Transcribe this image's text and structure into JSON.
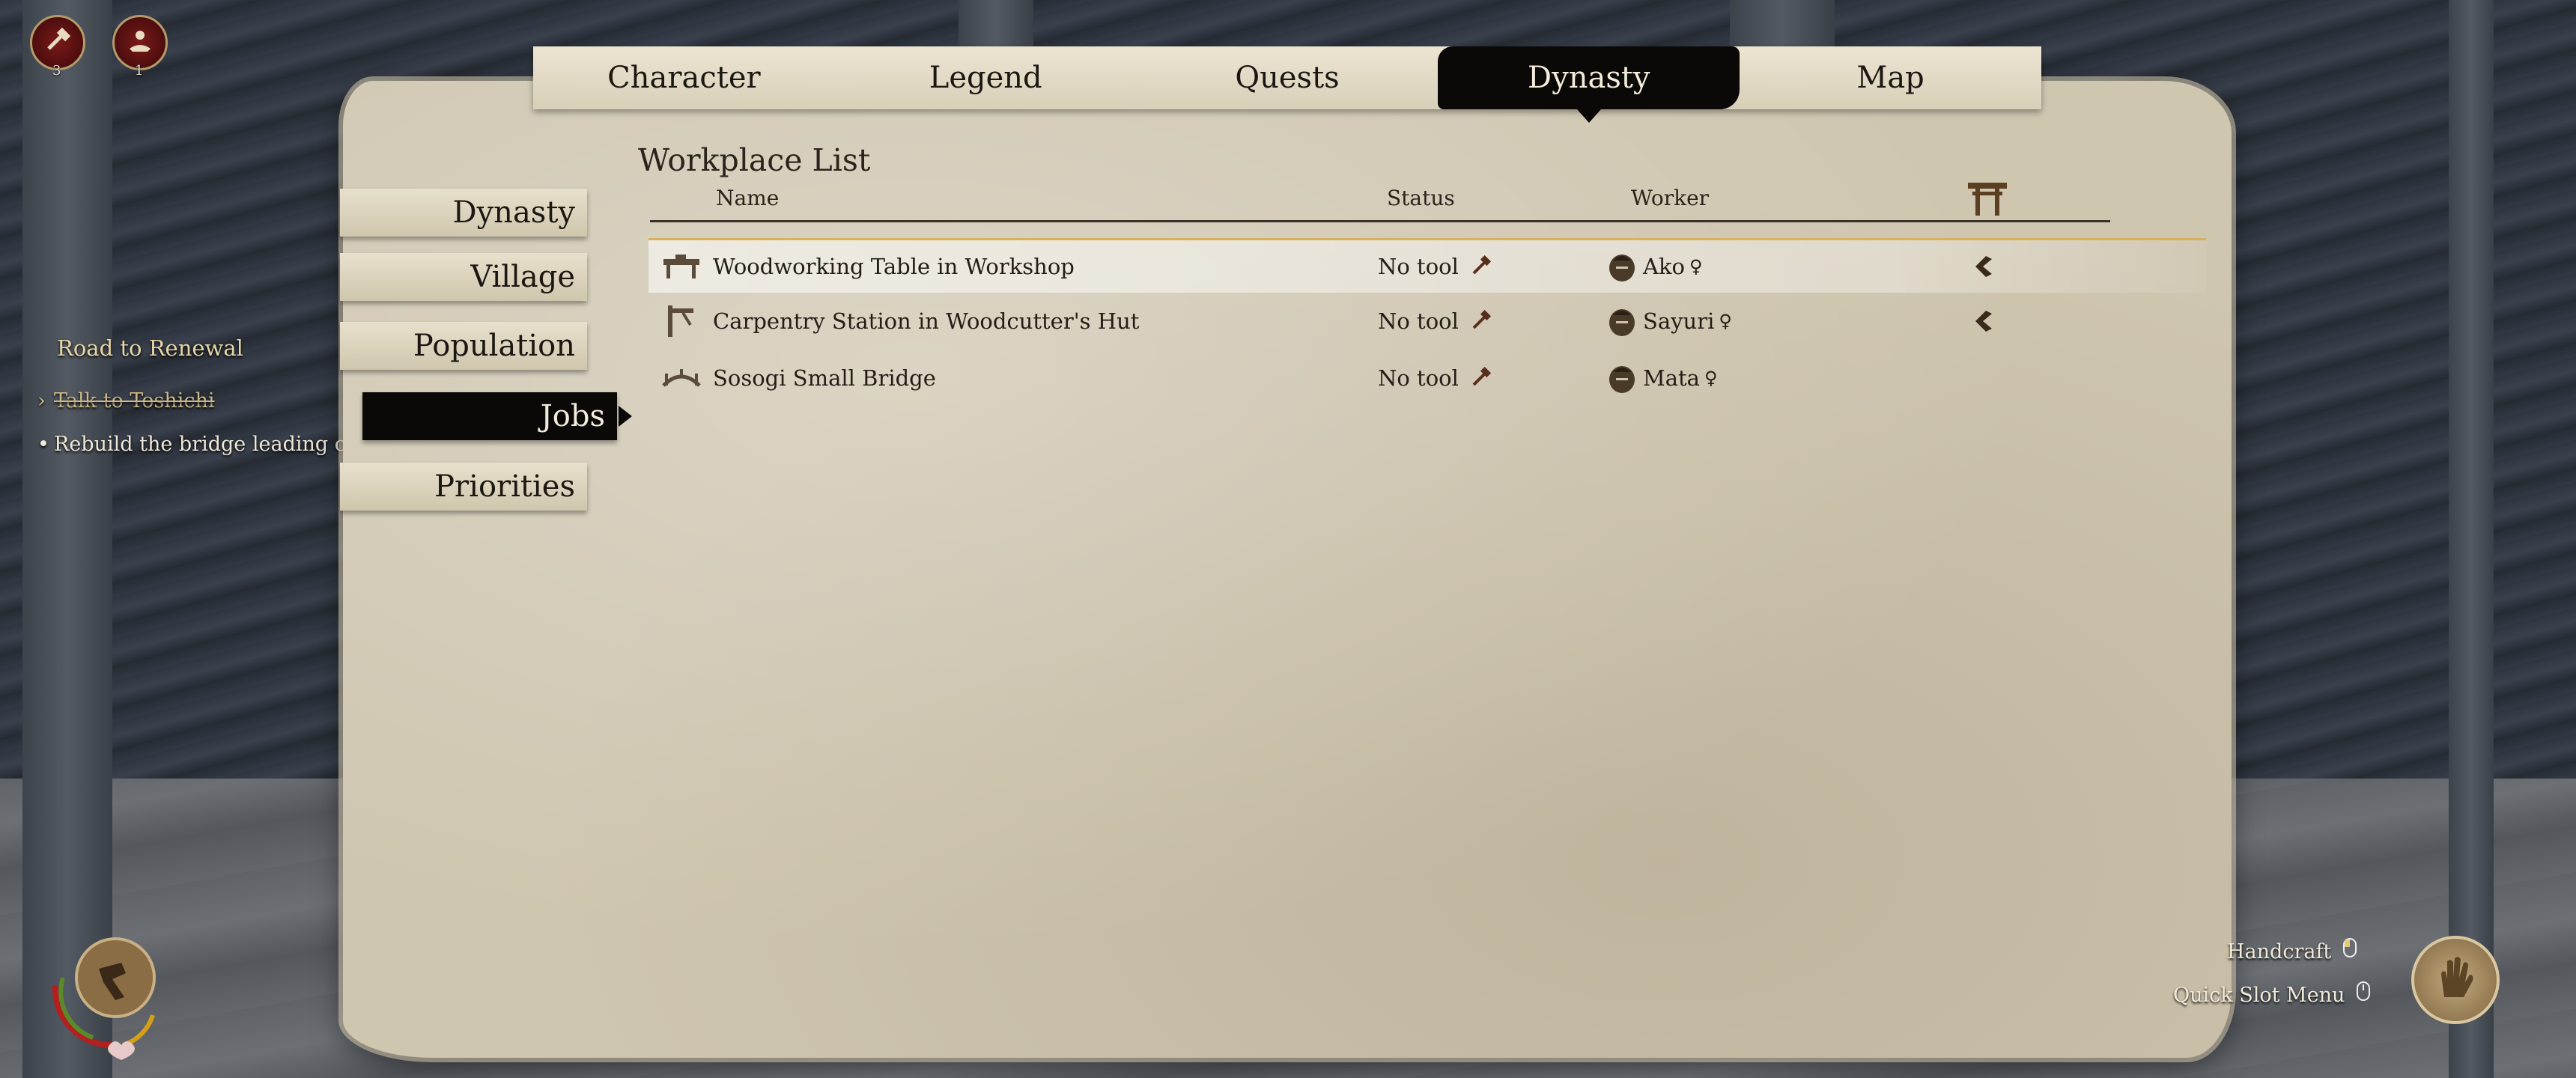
{
  "hud": {
    "badges": [
      {
        "icon": "hammer-icon",
        "count": "3"
      },
      {
        "icon": "villager-hand-icon",
        "count": "1"
      }
    ]
  },
  "tabs": [
    {
      "label": "Character",
      "active": false
    },
    {
      "label": "Legend",
      "active": false
    },
    {
      "label": "Quests",
      "active": false
    },
    {
      "label": "Dynasty",
      "active": true
    },
    {
      "label": "Map",
      "active": false
    }
  ],
  "side_menu": [
    {
      "label": "Dynasty",
      "active": false
    },
    {
      "label": "Village",
      "active": false
    },
    {
      "label": "Population",
      "active": false
    },
    {
      "label": "Jobs",
      "active": true
    },
    {
      "label": "Priorities",
      "active": false
    }
  ],
  "quest": {
    "title": "Road to Renewal",
    "steps": [
      {
        "label": "Talk to Toshichi",
        "done": true
      },
      {
        "label": "Rebuild the bridge leading out",
        "done": false
      }
    ]
  },
  "workplace": {
    "title": "Workplace List",
    "columns": {
      "name": "Name",
      "status": "Status",
      "worker": "Worker",
      "assign_icon": "shrine-gate-icon"
    },
    "rows": [
      {
        "icon": "workbench-icon",
        "name": "Woodworking Table in Workshop",
        "status": "No tool",
        "worker": "Ako",
        "gender": "♀",
        "has_action": true,
        "selected": true
      },
      {
        "icon": "carpentry-icon",
        "name": "Carpentry Station in Woodcutter's Hut",
        "status": "No tool",
        "worker": "Sayuri",
        "gender": "♀",
        "has_action": true,
        "selected": false
      },
      {
        "icon": "bridge-icon",
        "name": "Sosogi Small Bridge",
        "status": "No tool",
        "worker": "Mata",
        "gender": "♀",
        "has_action": false,
        "selected": false
      }
    ]
  },
  "prompts": {
    "handcraft": "Handcraft",
    "quick_slot": "Quick Slot Menu"
  },
  "colors": {
    "parchment": "#cfc6b0",
    "active_tab": "#0a0908",
    "quest_title": "#e6d6a8",
    "selection_border": "#d8b15a"
  }
}
